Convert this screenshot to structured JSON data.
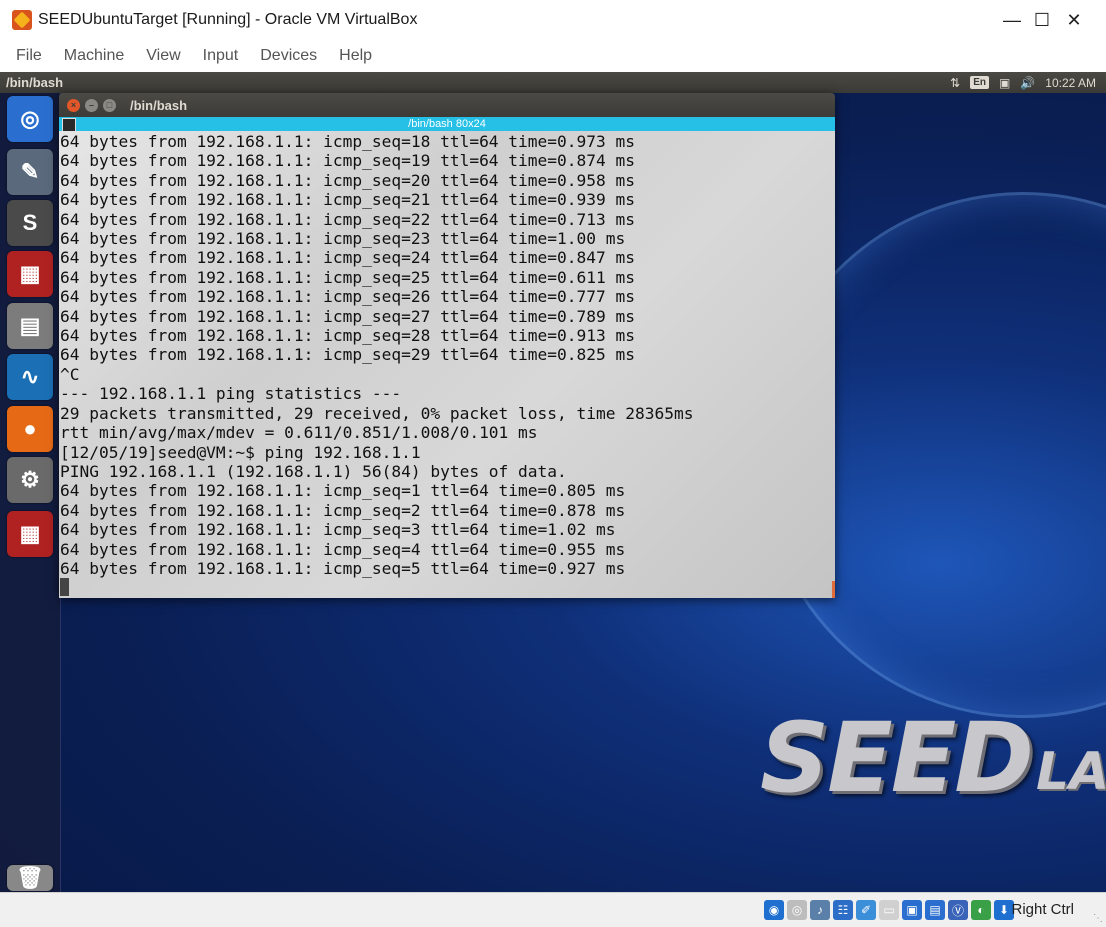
{
  "window": {
    "title": "SEEDUbuntuTarget [Running] - Oracle VM VirtualBox",
    "app_icon": "virtualbox-icon",
    "controls": [
      "minimize-icon",
      "maximize-icon",
      "close-icon"
    ]
  },
  "menubar": {
    "items": [
      "File",
      "Machine",
      "View",
      "Input",
      "Devices",
      "Help"
    ]
  },
  "guest_topbar": {
    "title": "/bin/bash",
    "language": "En",
    "time": "10:22 AM",
    "icons": [
      "network-updown-icon",
      "battery-icon",
      "volume-icon"
    ]
  },
  "launcher": {
    "items": [
      {
        "name": "ubuntu-dash-icon",
        "color": "#2a6fcf"
      },
      {
        "name": "text-editor-icon",
        "color": "#5a6a7c"
      },
      {
        "name": "sublime-text-icon",
        "color": "#4a4a4a"
      },
      {
        "name": "terminal-app-icon",
        "color": "#b02222"
      },
      {
        "name": "files-cabinet-icon",
        "color": "#7c7c7c"
      },
      {
        "name": "wireshark-icon",
        "color": "#1b6fb5"
      },
      {
        "name": "firefox-icon",
        "color": "#e66a16"
      },
      {
        "name": "system-settings-icon",
        "color": "#6a6a6a"
      },
      {
        "name": "terminal-active-icon",
        "color": "#b02222"
      },
      {
        "name": "trash-icon",
        "color": "#888888"
      }
    ]
  },
  "terminal": {
    "title": "/bin/bash",
    "tab_label": "/bin/bash 80x24",
    "lines": [
      "64 bytes from 192.168.1.1: icmp_seq=18 ttl=64 time=0.973 ms",
      "64 bytes from 192.168.1.1: icmp_seq=19 ttl=64 time=0.874 ms",
      "64 bytes from 192.168.1.1: icmp_seq=20 ttl=64 time=0.958 ms",
      "64 bytes from 192.168.1.1: icmp_seq=21 ttl=64 time=0.939 ms",
      "64 bytes from 192.168.1.1: icmp_seq=22 ttl=64 time=0.713 ms",
      "64 bytes from 192.168.1.1: icmp_seq=23 ttl=64 time=1.00 ms",
      "64 bytes from 192.168.1.1: icmp_seq=24 ttl=64 time=0.847 ms",
      "64 bytes from 192.168.1.1: icmp_seq=25 ttl=64 time=0.611 ms",
      "64 bytes from 192.168.1.1: icmp_seq=26 ttl=64 time=0.777 ms",
      "64 bytes from 192.168.1.1: icmp_seq=27 ttl=64 time=0.789 ms",
      "64 bytes from 192.168.1.1: icmp_seq=28 ttl=64 time=0.913 ms",
      "64 bytes from 192.168.1.1: icmp_seq=29 ttl=64 time=0.825 ms",
      "^C",
      "--- 192.168.1.1 ping statistics ---",
      "29 packets transmitted, 29 received, 0% packet loss, time 28365ms",
      "rtt min/avg/max/mdev = 0.611/0.851/1.008/0.101 ms",
      "[12/05/19]seed@VM:~$ ping 192.168.1.1",
      "PING 192.168.1.1 (192.168.1.1) 56(84) bytes of data.",
      "64 bytes from 192.168.1.1: icmp_seq=1 ttl=64 time=0.805 ms",
      "64 bytes from 192.168.1.1: icmp_seq=2 ttl=64 time=0.878 ms",
      "64 bytes from 192.168.1.1: icmp_seq=3 ttl=64 time=1.02 ms",
      "64 bytes from 192.168.1.1: icmp_seq=4 ttl=64 time=0.955 ms",
      "64 bytes from 192.168.1.1: icmp_seq=5 ttl=64 time=0.927 ms"
    ]
  },
  "wallpaper": {
    "logo_big": "SEED",
    "logo_small": "LABS"
  },
  "statusbar": {
    "icons": [
      {
        "name": "hard-disk-icon",
        "color": "#1f6fd1"
      },
      {
        "name": "optical-drive-icon",
        "color": "#bdbdbd"
      },
      {
        "name": "audio-icon",
        "color": "#5a7fa8"
      },
      {
        "name": "network-icon",
        "color": "#2c6ec7"
      },
      {
        "name": "usb-icon",
        "color": "#3b8ed8"
      },
      {
        "name": "shared-folders-icon",
        "color": "#d0d0d0"
      },
      {
        "name": "display-icon",
        "color": "#2a6fcf"
      },
      {
        "name": "video-capture-icon",
        "color": "#2a6fcf"
      },
      {
        "name": "virtualization-icon",
        "color": "#3a64b8"
      },
      {
        "name": "mouse-integration-icon",
        "color": "#3aa048"
      },
      {
        "name": "keyboard-capture-icon",
        "color": "#1f6fd1"
      }
    ],
    "host_key": "Right Ctrl"
  }
}
